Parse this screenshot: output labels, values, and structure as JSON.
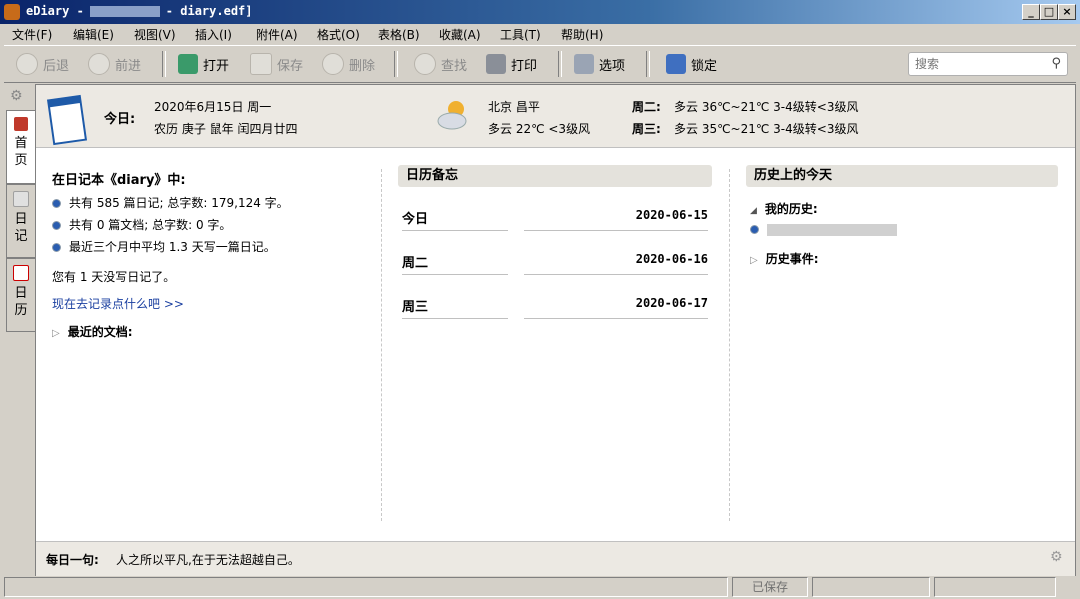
{
  "window": {
    "app_name": "eDiary -",
    "file_suffix": "- diary.edf]",
    "btn_min": "_",
    "btn_max": "□",
    "btn_close": "×"
  },
  "menu": [
    "文件(F)",
    "编辑(E)",
    "视图(V)",
    "插入(I)",
    "附件(A)",
    "格式(O)",
    "表格(B)",
    "收藏(A)",
    "工具(T)",
    "帮助(H)"
  ],
  "toolbar": {
    "back": "后退",
    "forward": "前进",
    "open": "打开",
    "save": "保存",
    "delete": "删除",
    "find": "查找",
    "print": "打印",
    "options": "选项",
    "lock": "锁定",
    "search_placeholder": "搜索"
  },
  "left_tabs": [
    {
      "label": "首页"
    },
    {
      "label": "日记"
    },
    {
      "label": "日历"
    }
  ],
  "header": {
    "today_label": "今日:",
    "date_line": "2020年6月15日  周一",
    "lunar_line": "农历 庚子 鼠年 闰四月廿四",
    "city": "北京 昌平",
    "today_weather": "多云 22℃ <3级风",
    "forecast": [
      {
        "day": "周二:",
        "text": "多云 36℃~21℃ 3-4级转<3级风"
      },
      {
        "day": "周三:",
        "text": "多云 35℃~21℃ 3-4级转<3级风"
      }
    ]
  },
  "stats": {
    "heading": "在日记本《diary》中:",
    "lines": [
      "共有 585 篇日记; 总字数: 179,124 字。",
      "共有 0 篇文档; 总字数: 0 字。",
      "最近三个月中平均 1.3 天写一篇日记。"
    ],
    "days_since": "您有 1 天没写日记了。",
    "write_link": "现在去记录点什么吧 >>",
    "recent_docs": "最近的文档:"
  },
  "memo": {
    "title": "日历备忘",
    "rows": [
      {
        "label": "今日",
        "date": "2020-06-15"
      },
      {
        "label": "周二",
        "date": "2020-06-16"
      },
      {
        "label": "周三",
        "date": "2020-06-17"
      }
    ]
  },
  "history": {
    "title": "历史上的今天",
    "my_history": "我的历史:",
    "events": "历史事件:"
  },
  "footer": {
    "label": "每日一句:",
    "quote": "人之所以平凡,在于无法超越自己。"
  },
  "status": {
    "saved": "已保存"
  },
  "colors": {
    "title_bar": "#0a246a",
    "link": "#1a3fa0",
    "chrome": "#d4d0c8"
  }
}
